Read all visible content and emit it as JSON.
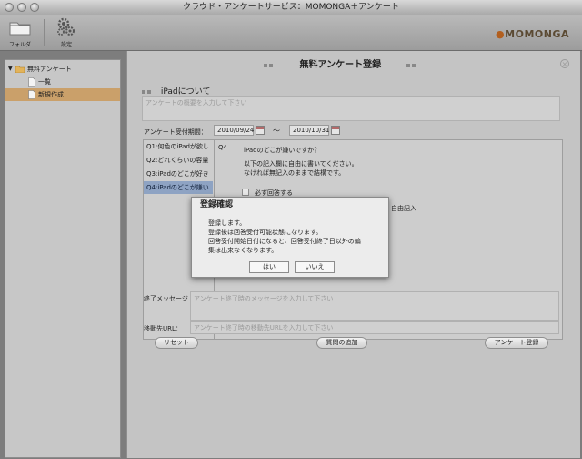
{
  "window": {
    "title": "クラウド・アンケートサービス：MOMONGA＋アンケート"
  },
  "toolbar": {
    "folder_label": "フォルダ",
    "settings_label": "設定",
    "logo": "MOMONGA"
  },
  "sidebar": {
    "root": "無料アンケート",
    "items": [
      {
        "label": "一覧"
      },
      {
        "label": "新規作成"
      }
    ]
  },
  "main": {
    "header": "無料アンケート登録",
    "about_title": "iPadについて",
    "summary_placeholder": "アンケートの概要を入力して下さい",
    "period_label": "アンケート受付期間：",
    "start_date": "2010/09/24",
    "tilde": "〜",
    "end_date": "2010/10/31",
    "questions": [
      {
        "label": "Q1:何色のiPadが欲し"
      },
      {
        "label": "Q2:どれくらいの容量"
      },
      {
        "label": "Q3:iPadのどこが好き"
      },
      {
        "label": "Q4:iPadのどこが嫌い"
      }
    ],
    "detail": {
      "qnum": "Q4",
      "question": "iPadのどこが嫌いですか？",
      "instruction_1": "以下の記入欄に自由に書いてください。",
      "instruction_2": "なければ無記入のままで結構です。",
      "required_label": "必ず回答する",
      "free_label": "自由記入"
    },
    "end_message_label": "終了メッセージ",
    "end_message_placeholder": "アンケート終了時のメッセージを入力して下さい",
    "redirect_label": "移動先URL：",
    "redirect_placeholder": "アンケート終了時の移動先URLを入力して下さい",
    "reset_button": "リセット",
    "add_question_button": "質問の追加",
    "register_button": "アンケート登録"
  },
  "dialog": {
    "title": "登録確認",
    "lines": [
      "登録します。",
      "登録後は回答受付可能状態になります。",
      "回答受付開始日付になると、回答受付終了日以外の編",
      "集は出来なくなります。"
    ],
    "yes": "はい",
    "no": "いいえ"
  }
}
